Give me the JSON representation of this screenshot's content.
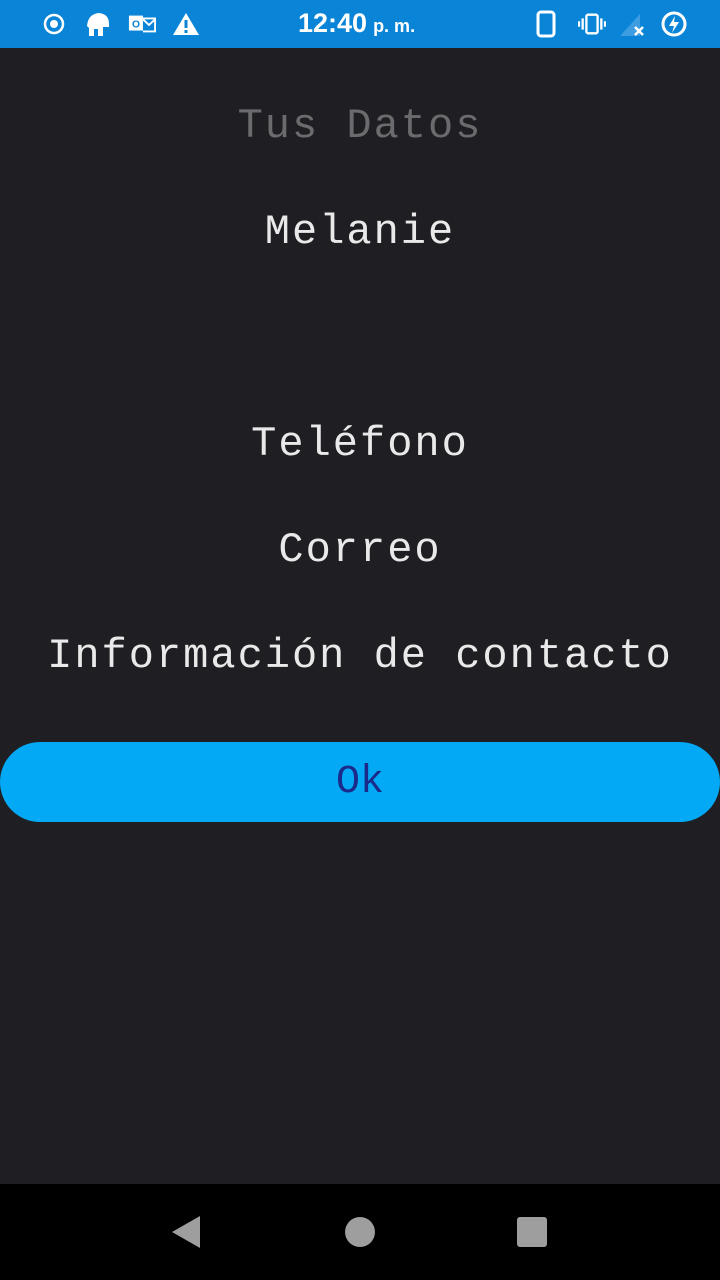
{
  "status_bar": {
    "time": "12:40",
    "ampm": "p. m.",
    "background": "#0a84d6",
    "left_icons": [
      "record-icon",
      "helmet-icon",
      "outlook-icon",
      "warning-icon"
    ],
    "right_icons": [
      "phone-icon",
      "vibrate-icon",
      "no-signal-icon",
      "battery-charging-icon"
    ]
  },
  "screen": {
    "title": "Tus Datos",
    "name": "Melanie",
    "phone_label": "Teléfono",
    "email_label": "Correo",
    "contact_label": "Información de contacto",
    "ok_label": "Ok",
    "background": "#1f1e23",
    "button_color": "#03a9f4"
  },
  "nav_bar": {
    "icons": [
      "back-icon",
      "home-icon",
      "recents-icon"
    ]
  }
}
